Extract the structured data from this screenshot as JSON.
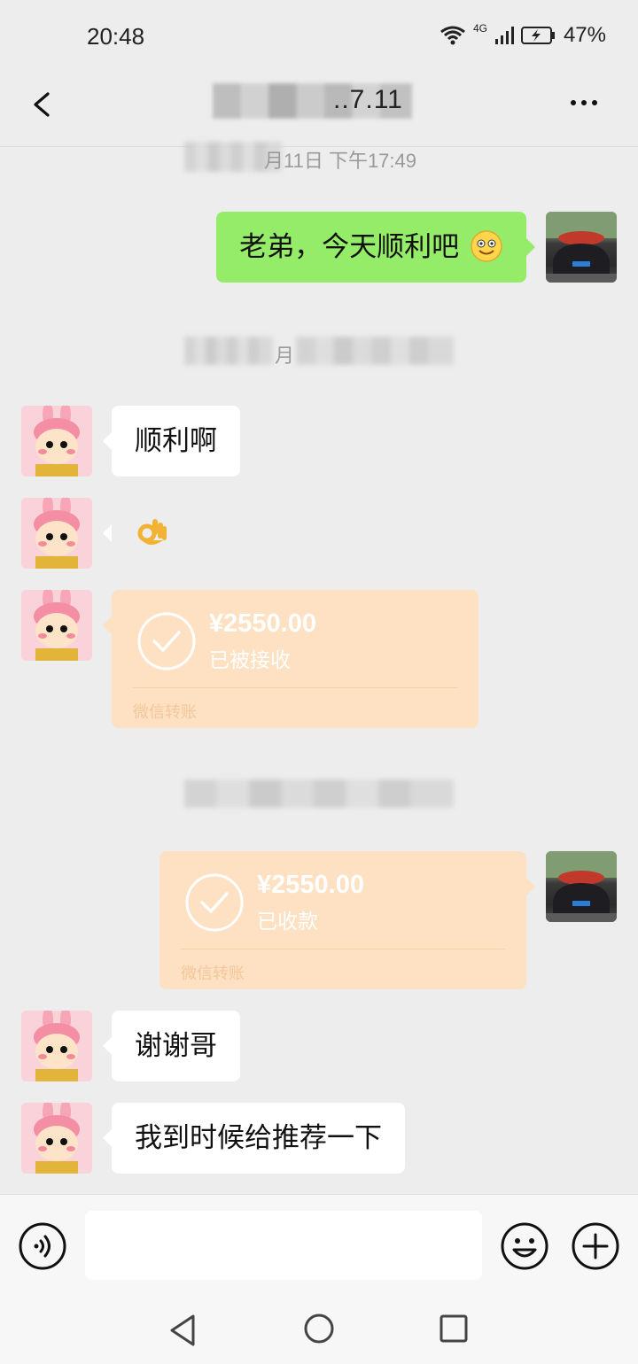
{
  "status_bar": {
    "time": "20:48",
    "network": "4G",
    "battery": "47%"
  },
  "header": {
    "title_visible_tail": "..7.11"
  },
  "timestamps": {
    "ts1_visible": "月11日 下午17:49",
    "ts2_visible": "月"
  },
  "messages": {
    "m1": "老弟，今天顺利吧",
    "m2": "顺利啊",
    "m3": "👌",
    "m6": "谢谢哥",
    "m7": "我到时候给推荐一下"
  },
  "transfers": {
    "t1": {
      "amount": "¥2550.00",
      "status": "已被接收",
      "brand": "微信转账"
    },
    "t2": {
      "amount": "¥2550.00",
      "status": "已收款",
      "brand": "微信转账"
    }
  },
  "input": {
    "placeholder": ""
  },
  "colors": {
    "background": "#ededed",
    "my_bubble": "#95ec69",
    "their_bubble": "#ffffff",
    "transfer_card": "#fde1c2"
  }
}
